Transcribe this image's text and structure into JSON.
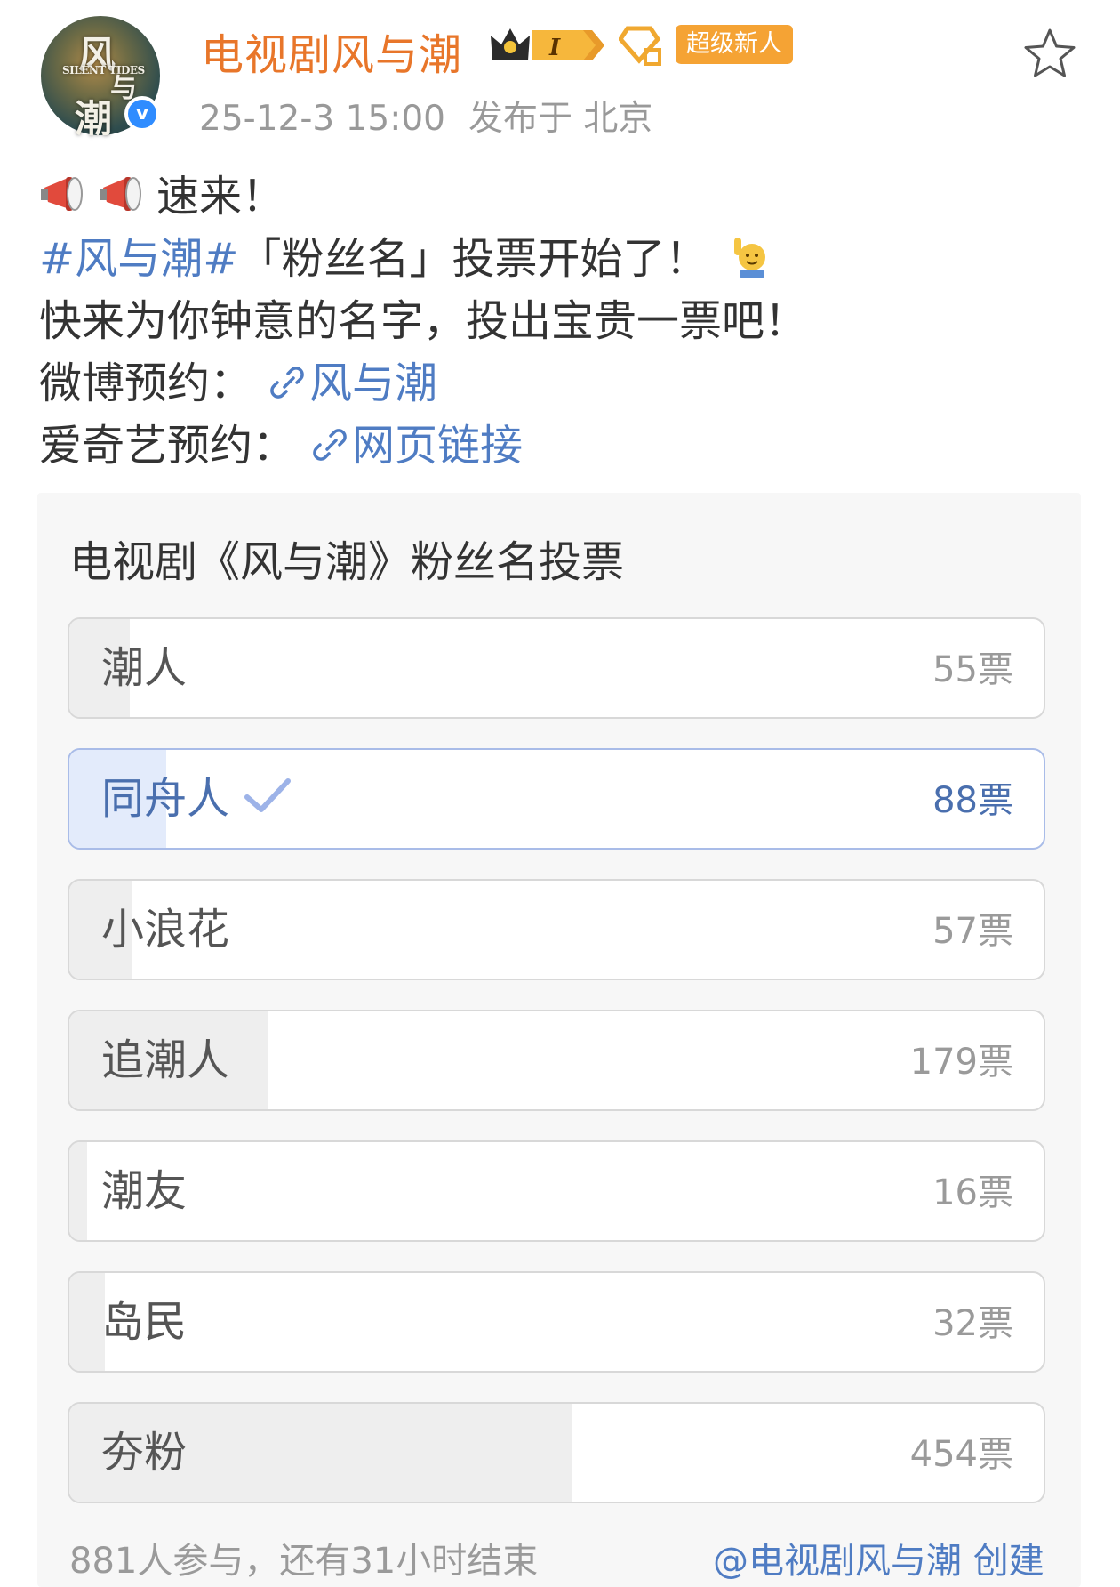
{
  "header": {
    "username": "电视剧风与潮",
    "level_badge": "I",
    "new_badge": "超级新人",
    "timestamp": "25-12-3 15:00",
    "location": "发布于 北京",
    "avatar_text": {
      "t1": "风",
      "t2": "SILENT TIDES",
      "t3": "与",
      "t4": "潮"
    },
    "verified_mark": "v"
  },
  "post": {
    "line1_text": "速来！",
    "line2_tag": "#风与潮#",
    "line2_text": "「粉丝名」投票开始了！",
    "line3_text": "快来为你钟意的名字，投出宝贵一票吧！",
    "line4_label": "微博预约：",
    "line4_link": "风与潮",
    "line5_label": "爱奇艺预约：",
    "line5_link": "网页链接"
  },
  "poll": {
    "title": "电视剧《风与潮》粉丝名投票",
    "options": [
      {
        "label": "潮人",
        "votes": "55票",
        "count": 55
      },
      {
        "label": "同舟人",
        "votes": "88票",
        "count": 88,
        "selected": true
      },
      {
        "label": "小浪花",
        "votes": "57票",
        "count": 57
      },
      {
        "label": "追潮人",
        "votes": "179票",
        "count": 179
      },
      {
        "label": "潮友",
        "votes": "16票",
        "count": 16
      },
      {
        "label": "岛民",
        "votes": "32票",
        "count": 32
      },
      {
        "label": "夯粉",
        "votes": "454票",
        "count": 454
      }
    ],
    "footer_left": "881人参与，还有31小时结束",
    "footer_right": "@电视剧风与潮 创建"
  },
  "colors": {
    "username": "#e8762a",
    "link": "#4f7cc3",
    "selected_border": "#a9bce8",
    "selected_fill": "#e3ebfb"
  },
  "icons": [
    "megaphone-icon",
    "raising-hand-emoji",
    "link-icon",
    "star-icon",
    "crown-badge-icon",
    "diamond-badge-icon",
    "checkmark-icon"
  ]
}
